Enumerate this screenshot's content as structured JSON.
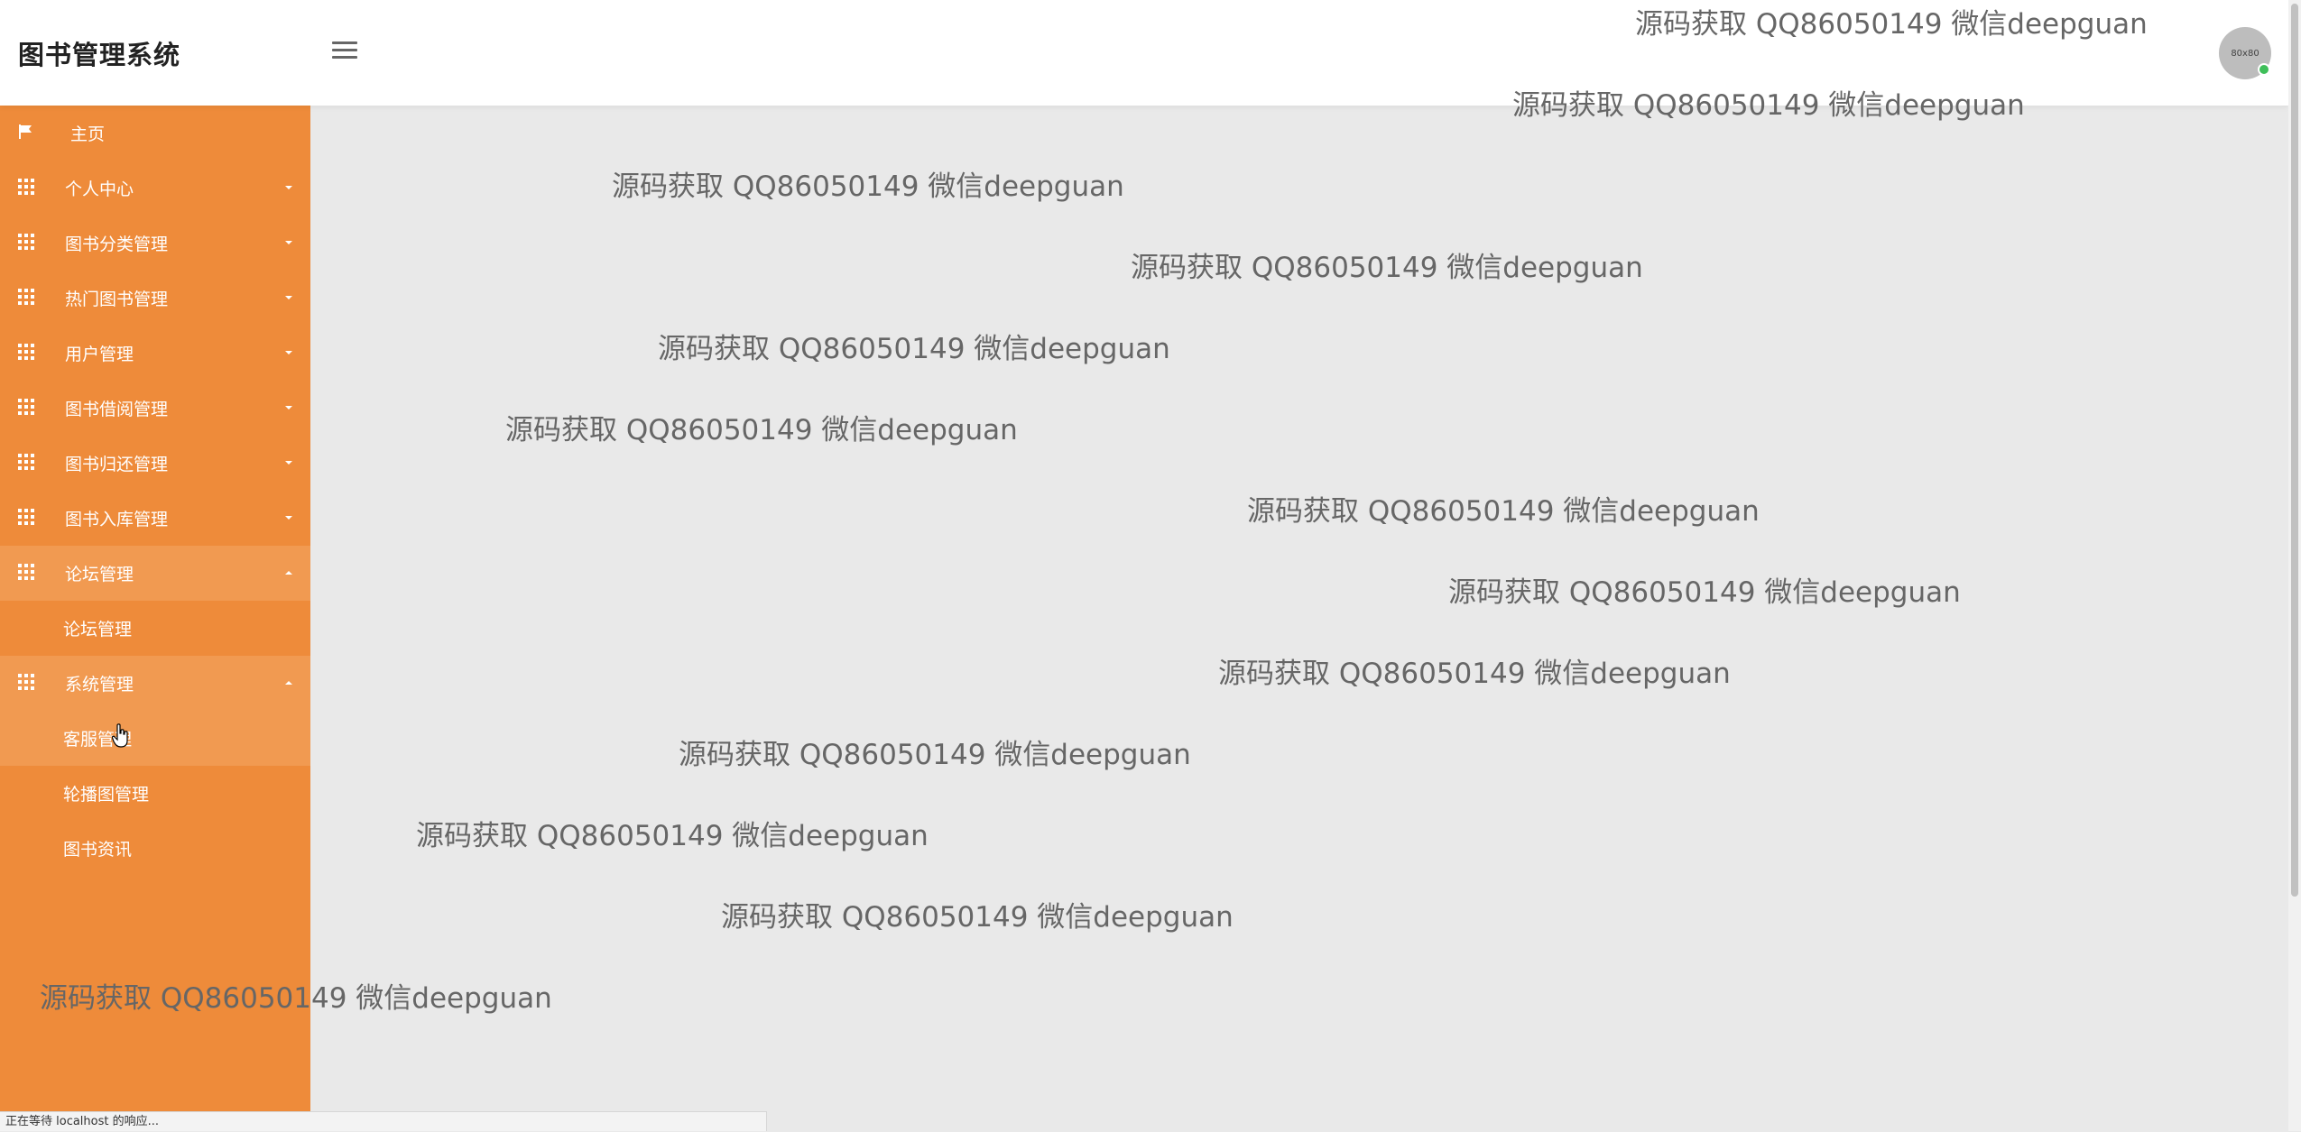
{
  "header": {
    "app_title": "图书管理系统",
    "avatar_text": "80x80"
  },
  "sidebar": {
    "items": [
      {
        "label": "主页",
        "icon": "flag-icon"
      },
      {
        "label": "个人中心",
        "icon": "grid-icon"
      },
      {
        "label": "图书分类管理",
        "icon": "grid-icon"
      },
      {
        "label": "热门图书管理",
        "icon": "grid-icon"
      },
      {
        "label": "用户管理",
        "icon": "grid-icon"
      },
      {
        "label": "图书借阅管理",
        "icon": "grid-icon"
      },
      {
        "label": "图书归还管理",
        "icon": "grid-icon"
      },
      {
        "label": "图书入库管理",
        "icon": "grid-icon"
      },
      {
        "label": "论坛管理",
        "icon": "grid-icon",
        "expanded": true,
        "children": [
          {
            "label": "论坛管理"
          }
        ]
      },
      {
        "label": "系统管理",
        "icon": "grid-icon",
        "expanded": true,
        "children": [
          {
            "label": "客服管理"
          },
          {
            "label": "轮播图管理"
          },
          {
            "label": "图书资讯"
          }
        ]
      }
    ]
  },
  "watermark_text": "源码获取 QQ86050149 微信deepguan",
  "status_bar": {
    "text": "正在等待 localhost 的响应..."
  },
  "colors": {
    "sidebar_bg": "#ee8b3a",
    "sidebar_expanded_bg": "#f19a51",
    "content_bg": "#e9e9e9",
    "online_dot": "#3fbf5a"
  }
}
